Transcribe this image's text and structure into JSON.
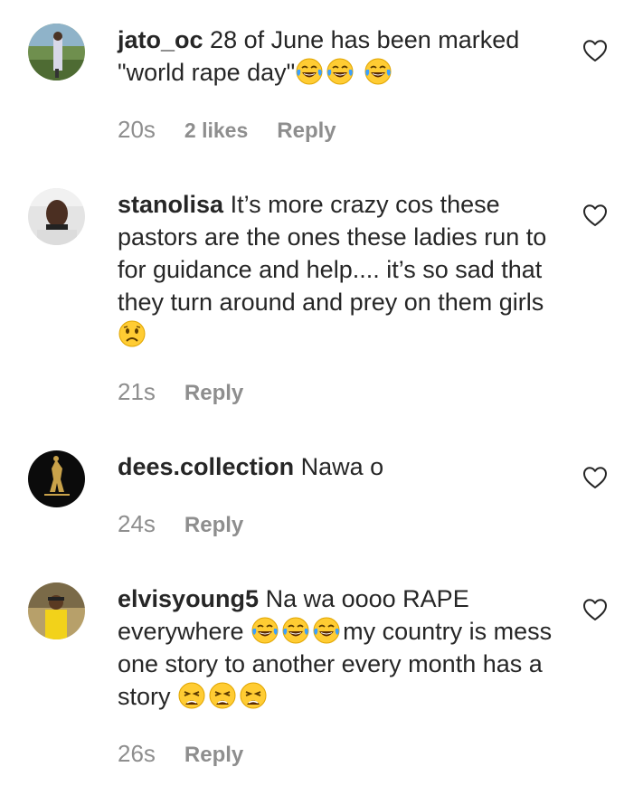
{
  "comments": [
    {
      "username": "jato_oc",
      "text": "28 of June has been marked \"world rape day\"",
      "emojis": [
        "tears-of-joy",
        "tears-of-joy",
        "tears-of-joy"
      ],
      "time": "20s",
      "likes": "2 likes",
      "reply": "Reply"
    },
    {
      "username": "stanolisa",
      "text": "It’s more crazy cos these pastors are the ones these ladies run to for guidance and help.... it’s so sad that they turn around and prey on them girls",
      "emojis": [
        "frowning-face"
      ],
      "time": "21s",
      "reply": "Reply"
    },
    {
      "username": "dees.collection",
      "text": "Nawa o",
      "time": "24s",
      "reply": "Reply"
    },
    {
      "username": "elvisyoung5",
      "text_a": "Na wa oooo RAPE everywhere",
      "emojis_a": [
        "tears-of-joy",
        "tears-of-joy",
        "tears-of-joy"
      ],
      "text_b": "my country is mess one story to another every month has a story",
      "emojis_b": [
        "weary-face",
        "weary-face",
        "weary-face"
      ],
      "time": "26s",
      "reply": "Reply"
    }
  ],
  "icons": {
    "like": "heart-outline-icon"
  },
  "colors": {
    "text": "#262626",
    "meta": "#8e8e8e",
    "background": "#ffffff"
  }
}
